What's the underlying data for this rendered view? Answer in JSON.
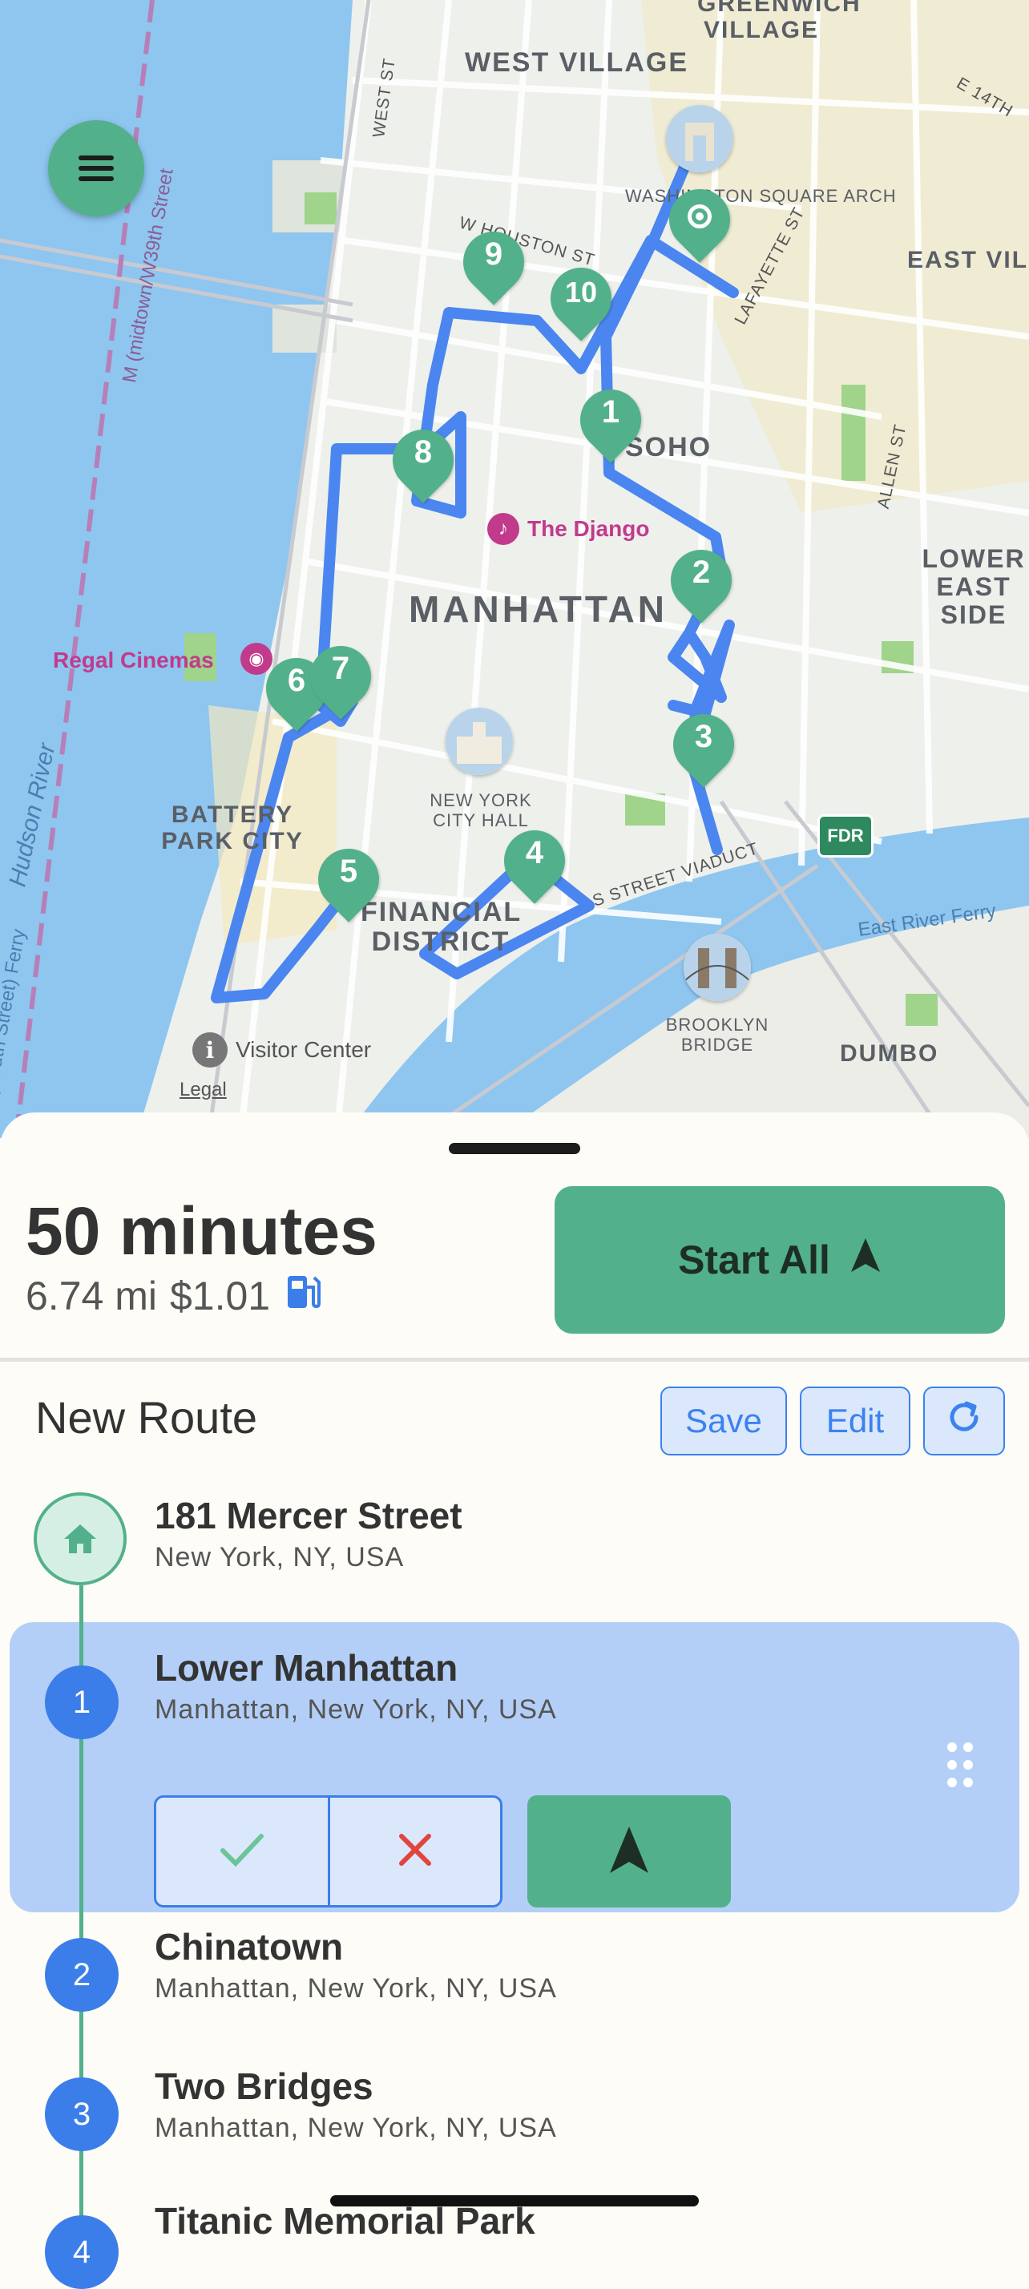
{
  "map": {
    "neighborhoods": [
      "WEST VILLAGE",
      "GREENWICH VILLAGE",
      "EAST VILLAGE",
      "SOHO",
      "MANHATTAN",
      "LOWER EAST SIDE",
      "BATTERY PARK CITY",
      "FINANCIAL DISTRICT",
      "DUMBO"
    ],
    "streets": [
      "WEST ST",
      "W HOUSTON ST",
      "LAFAYETTE ST",
      "ALLEN ST",
      "E 14TH",
      "S STREET VIADUCT",
      "FDR"
    ],
    "water": [
      "M (midtown/W39th Street",
      "East River Ferry",
      "Hudson River",
      "(South Street) Ferry"
    ],
    "pois": [
      {
        "label": "The Django",
        "icon": "music-note-icon",
        "color": "#c23a8c"
      },
      {
        "label": "Regal Cinemas",
        "icon": "film-icon",
        "color": "#c23a8c"
      },
      {
        "label": "Visitor Center",
        "icon": "info-icon",
        "color": "#555555"
      }
    ],
    "landmarks": [
      "WASHINGTON SQUARE ARCH",
      "NEW YORK CITY HALL",
      "BROOKLYN BRIDGE"
    ],
    "legal": "Legal",
    "pins": [
      "1",
      "2",
      "3",
      "4",
      "5",
      "6",
      "7",
      "8",
      "9",
      "10"
    ],
    "route_color": "#4b86f0",
    "pin_color": "#52b18a"
  },
  "menu_button": {
    "icon": "hamburger-menu-icon"
  },
  "summary": {
    "duration": "50 minutes",
    "distance": "6.74 mi",
    "cost": "$1.01",
    "fuel_icon": "fuel-pump-icon"
  },
  "start_all": {
    "label": "Start All",
    "icon": "navigation-arrow-icon"
  },
  "route": {
    "title": "New Route",
    "save_label": "Save",
    "edit_label": "Edit",
    "refresh_icon": "refresh-icon"
  },
  "stops": [
    {
      "badge": "home",
      "name": "181 Mercer Street",
      "address": "New York, NY, USA"
    },
    {
      "badge": "1",
      "name": "Lower Manhattan",
      "address": "Manhattan, New York, NY, USA",
      "active": true
    },
    {
      "badge": "2",
      "name": "Chinatown",
      "address": "Manhattan, New York, NY, USA"
    },
    {
      "badge": "3",
      "name": "Two Bridges",
      "address": "Manhattan, New York, NY, USA"
    },
    {
      "badge": "4",
      "name": "Titanic Memorial Park",
      "address": ""
    }
  ],
  "colors": {
    "accent_green": "#52b18a",
    "accent_blue": "#3b7ee9",
    "active_card": "#b4cff7"
  }
}
